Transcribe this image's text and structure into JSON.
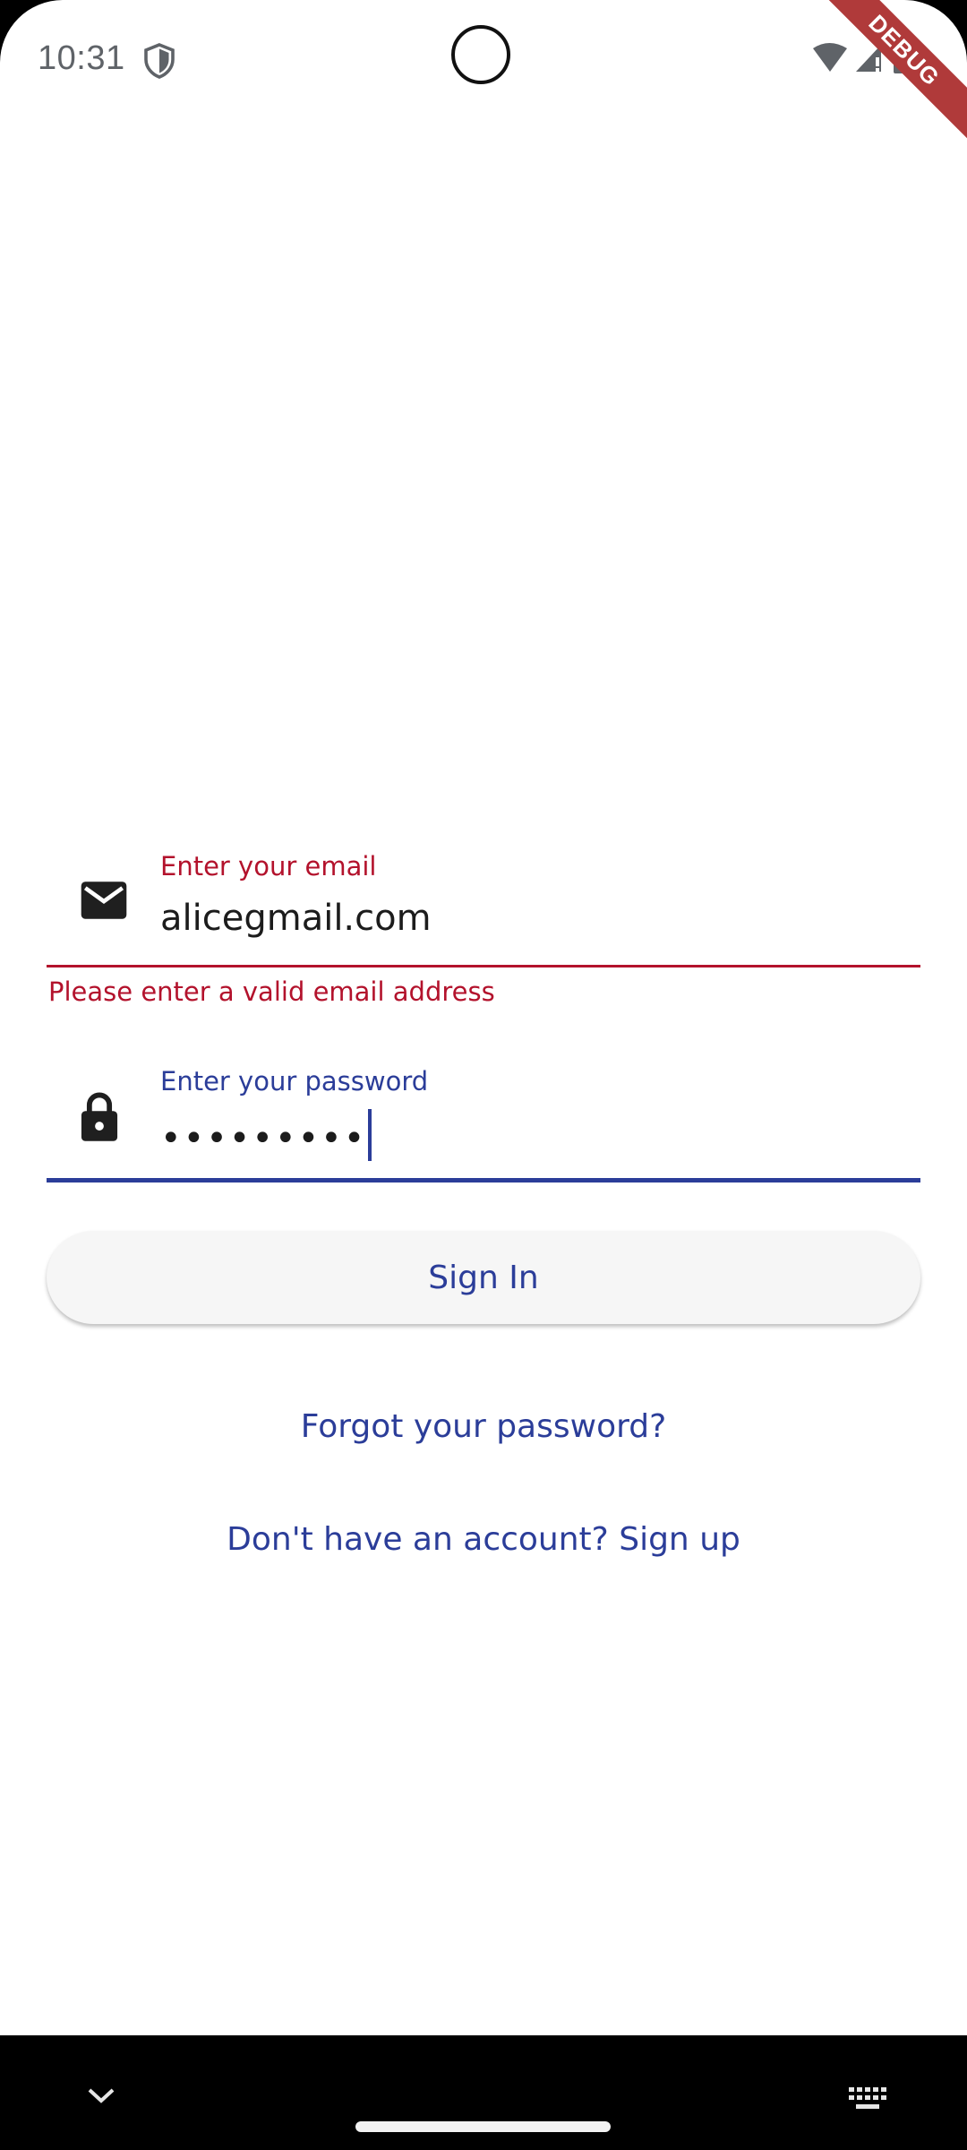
{
  "status_bar": {
    "time": "10:31",
    "icons": [
      "shield-icon",
      "wifi-icon",
      "signal-icon",
      "battery-icon"
    ]
  },
  "debug_banner": {
    "label": "DEBUG",
    "color": "#b03a3a"
  },
  "form": {
    "email": {
      "label": "Enter your email",
      "value": "alicegmail.com",
      "error": "Please enter a valid email address",
      "icon": "mail-icon",
      "state": "error",
      "color": "#b3122c"
    },
    "password": {
      "label": "Enter your password",
      "value": "•••••••••",
      "icon": "lock-icon",
      "state": "focused",
      "color": "#2b3d99"
    },
    "sign_in_label": "Sign In",
    "forgot_label": "Forgot your password?",
    "signup_label": "Don't have an account? Sign up"
  },
  "nav_bar": {
    "icons": [
      "chevron-down-icon",
      "home-handle",
      "keyboard-icon"
    ]
  },
  "colors": {
    "accent": "#2b3d99",
    "error": "#b3122c",
    "background": "#ffffff",
    "button_bg": "#f6f6f6"
  }
}
